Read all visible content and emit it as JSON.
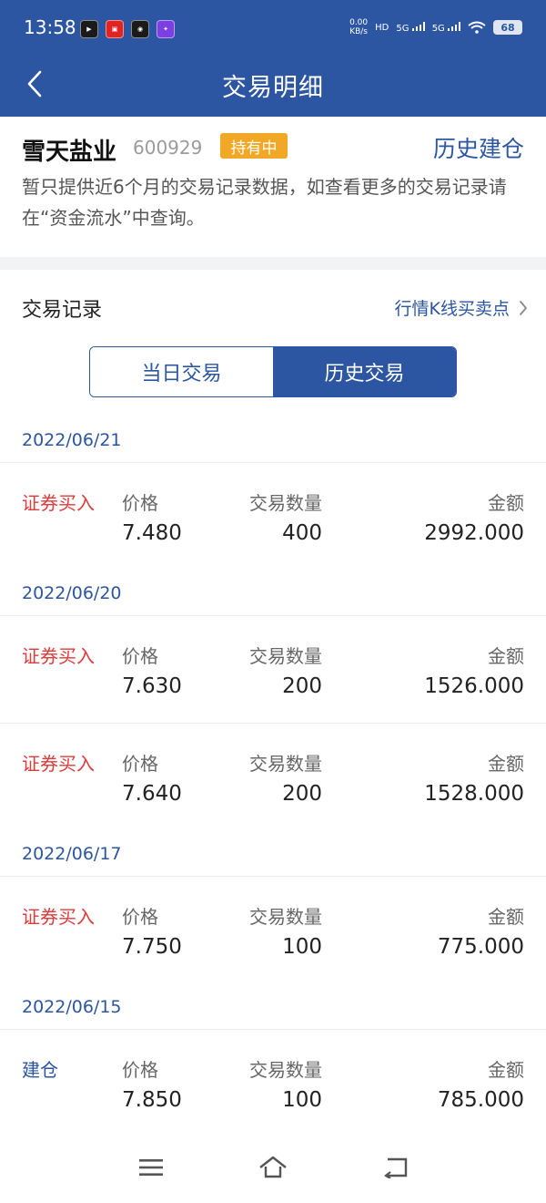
{
  "status_bar": {
    "time": "13:58",
    "net_speed_value": "0.00",
    "net_speed_unit": "KB/s",
    "hd_label": "HD",
    "signal1_label": "5G",
    "signal2_label": "5G",
    "battery": "68",
    "app_icons": [
      "video-app-icon",
      "xiaohongshu-app-icon",
      "video-app-icon-2",
      "news-app-icon"
    ]
  },
  "header": {
    "title": "交易明细",
    "back_icon": "chevron-left-icon"
  },
  "stock": {
    "name": "雪天盐业",
    "code": "600929",
    "badge": "持有中",
    "history_build_label": "历史建仓",
    "notice": "暂只提供近6个月的交易记录数据，如查看更多的交易记录请在“资金流水”中查询。"
  },
  "records": {
    "title": "交易记录",
    "kline_link": "行情K线买卖点",
    "kline_icon": "chevron-right-icon",
    "tabs": [
      {
        "label": "当日交易",
        "selected": false
      },
      {
        "label": "历史交易",
        "selected": true
      }
    ]
  },
  "labels": {
    "price": "价格",
    "qty": "交易数量",
    "amount": "金额"
  },
  "groups": [
    {
      "date": "2022/06/21",
      "trades": [
        {
          "type": "证券买入",
          "kind": "buy",
          "price": "7.480",
          "qty": "400",
          "amount": "2992.000"
        }
      ]
    },
    {
      "date": "2022/06/20",
      "trades": [
        {
          "type": "证券买入",
          "kind": "buy",
          "price": "7.630",
          "qty": "200",
          "amount": "1526.000"
        },
        {
          "type": "证券买入",
          "kind": "buy",
          "price": "7.640",
          "qty": "200",
          "amount": "1528.000"
        }
      ]
    },
    {
      "date": "2022/06/17",
      "trades": [
        {
          "type": "证券买入",
          "kind": "buy",
          "price": "7.750",
          "qty": "100",
          "amount": "775.000"
        }
      ]
    },
    {
      "date": "2022/06/15",
      "trades": [
        {
          "type": "建仓",
          "kind": "build",
          "price": "7.850",
          "qty": "100",
          "amount": "785.000"
        }
      ]
    }
  ],
  "nav_bar": {
    "icons": [
      "menu-icon",
      "home-icon",
      "back-icon"
    ]
  },
  "colors": {
    "primary": "#2c55a2",
    "buy": "#e03a3a",
    "badge": "#f0a826"
  }
}
